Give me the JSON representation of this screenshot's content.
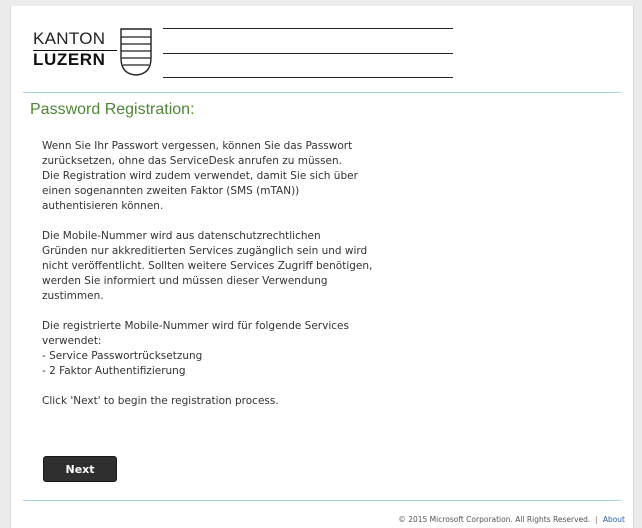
{
  "header": {
    "logo_line1": "KANTON",
    "logo_line2": "LUZERN"
  },
  "page": {
    "title": "Password Registration:"
  },
  "content": {
    "paragraph1_line1": "Wenn Sie Ihr Passwort vergessen, können Sie das Passwort",
    "paragraph1_line2": "zurücksetzen, ohne das ServiceDesk anrufen zu müssen.",
    "paragraph1_line3": "Die Registration wird zudem verwendet, damit Sie sich über",
    "paragraph1_line4": "einen sogenannten zweiten Faktor (SMS (mTAN))",
    "paragraph1_line5": "authentisieren können.",
    "paragraph2_line1": "Die Mobile-Nummer wird aus datenschutzrechtlichen",
    "paragraph2_line2": "Gründen nur akkreditierten Services zugänglich sein und wird",
    "paragraph2_line3": "nicht veröffentlicht. Sollten weitere Services Zugriff benötigen,",
    "paragraph2_line4": "werden Sie informiert und müssen dieser Verwendung",
    "paragraph2_line5": "zustimmen.",
    "paragraph3_line1": "Die registrierte Mobile-Nummer wird für folgende Services",
    "paragraph3_line2": "verwendet:",
    "paragraph3_line3": "- Service Passwortrücksetzung",
    "paragraph3_line4": "- 2 Faktor Authentifizierung",
    "instruction": "Click 'Next' to begin the registration process."
  },
  "actions": {
    "next_label": "Next"
  },
  "footer": {
    "copyright": "© 2015 Microsoft Corporation. All Rights Reserved.",
    "separator": "|",
    "about_label": "About"
  },
  "colors": {
    "title": "#4e8735",
    "divider": "#a8d4e3",
    "button_bg": "#2f2f2f",
    "link": "#2a5db0"
  }
}
